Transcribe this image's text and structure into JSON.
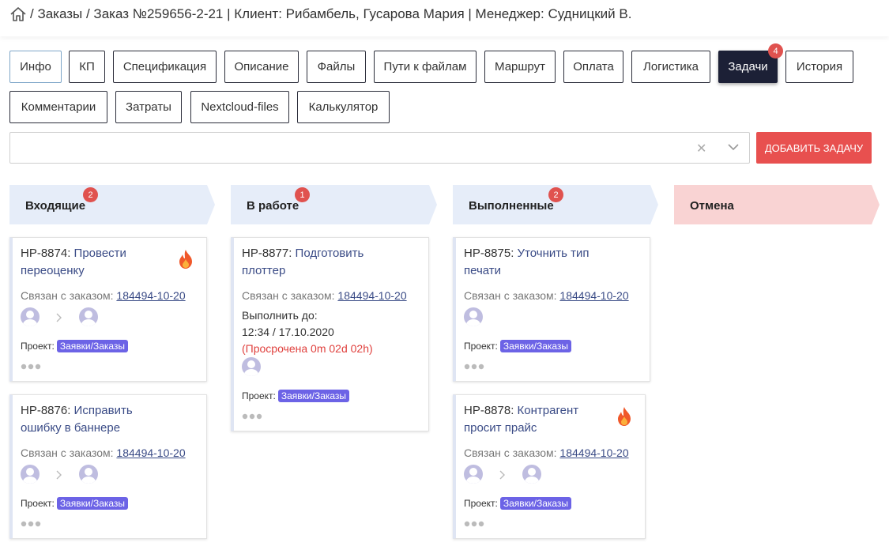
{
  "breadcrumb": {
    "text": "/ Заказы / Заказ №259656-2-21 | Клиент: Рибамбель, Гусарова Мария | Менеджер: Судницкий В."
  },
  "tabs": [
    {
      "label": "Инфо"
    },
    {
      "label": "КП"
    },
    {
      "label": "Спецификация"
    },
    {
      "label": "Описание"
    },
    {
      "label": "Файлы"
    },
    {
      "label": "Пути к файлам"
    },
    {
      "label": "Маршрут"
    },
    {
      "label": "Оплата"
    },
    {
      "label": "Логистика"
    },
    {
      "label": "Задачи",
      "badge": "4",
      "active": true
    },
    {
      "label": "История"
    },
    {
      "label": "Комментарии"
    },
    {
      "label": "Затраты"
    },
    {
      "label": "Nextcloud-files"
    },
    {
      "label": "Калькулятор"
    }
  ],
  "filter": {
    "value": "",
    "clear_icon": "clear-icon",
    "dropdown_icon": "chevron-down-icon"
  },
  "add_task_button": "ДОБАВИТЬ ЗАДАЧУ",
  "colors": {
    "accent_dark": "#1c2036",
    "danger": "#e8504f",
    "tag": "#6c63e6",
    "link": "#3a4b86",
    "column_head": "#e6edf9",
    "cancel_head": "#f9d3d3"
  },
  "columns": [
    {
      "title": "Входящие",
      "badge": "2"
    },
    {
      "title": "В работе",
      "badge": "1"
    },
    {
      "title": "Выполненные",
      "badge": "2"
    },
    {
      "title": "Отмена"
    }
  ],
  "cards": [
    {
      "id": "HP-8874:",
      "title": "Провести переоценку",
      "urgent": true,
      "linked_label": "Связан с заказом:",
      "order": "184494-10-20",
      "project_label": "Проект:",
      "project": "Заявки/Заказы"
    },
    {
      "id": "HP-8876:",
      "title": "Исправить ошибку в баннере",
      "urgent": false,
      "linked_label": "Связан с заказом:",
      "order": "184494-10-20",
      "project_label": "Проект:",
      "project": "Заявки/Заказы"
    },
    {
      "id": "HP-8877:",
      "title": "Подготовить плоттер",
      "urgent": false,
      "linked_label": "Связан с заказом:",
      "order": "184494-10-20",
      "due_label": "Выполнить до:",
      "due": "12:34 / 17.10.2020",
      "overdue": "(Просрочена 0m 02d 02h)",
      "project_label": "Проект:",
      "project": "Заявки/Заказы"
    },
    {
      "id": "HP-8875:",
      "title": "Уточнить тип печати",
      "urgent": false,
      "linked_label": "Связан с заказом:",
      "order": "184494-10-20",
      "project_label": "Проект:",
      "project": "Заявки/Заказы"
    },
    {
      "id": "HP-8878:",
      "title": "Контрагент просит прайс",
      "urgent": true,
      "linked_label": "Связан с заказом:",
      "order": "184494-10-20",
      "project_label": "Проект:",
      "project": "Заявки/Заказы"
    }
  ]
}
